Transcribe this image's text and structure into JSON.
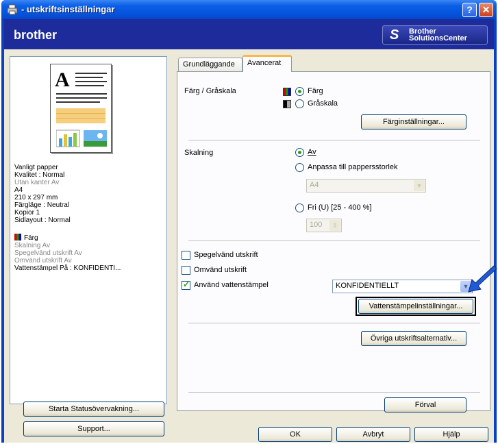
{
  "window": {
    "title": "- utskriftsinställningar",
    "help_glyph": "?",
    "close_glyph": "✕"
  },
  "brand": {
    "logo": "brother",
    "solutions_line1": "Brother",
    "solutions_line2": "SolutionsCenter"
  },
  "summary": {
    "lines": [
      "Vanligt papper",
      "Kvalitet : Normal",
      "Utan kanter Av",
      "A4",
      "210 x 297 mm",
      "Färgläge : Neutral",
      "Kopior 1",
      "Sidlayout : Normal"
    ],
    "color": "Färg",
    "details": [
      "Skalning Av",
      "Spegelvänd utskrift Av",
      "Omvänd utskrift Av",
      "Vattenstämpel På : KONFIDENTI..."
    ]
  },
  "left_buttons": {
    "status": "Starta Statusövervakning...",
    "support": "Support..."
  },
  "tabs": {
    "basic": "Grundläggande",
    "advanced": "Avancerat"
  },
  "color_section": {
    "label": "Färg / Gråskala",
    "color_option": "Färg",
    "gray_option": "Gråskala",
    "settings_button": "Färginställningar..."
  },
  "scaling_section": {
    "label": "Skalning",
    "off": "Av",
    "fit": "Anpassa till pappersstorlek",
    "paper_size": "A4",
    "free": "Fri (U) [25 - 400 %]",
    "percent": "100"
  },
  "options": {
    "mirror": "Spegelvänd utskrift",
    "reverse": "Omvänd utskrift",
    "watermark": "Använd vattenstämpel",
    "watermark_value": "KONFIDENTIELLT",
    "watermark_settings": "Vattenstämpelinställningar...",
    "other_options": "Övriga utskriftsalternativ...",
    "default": "Förval"
  },
  "footer": {
    "ok": "OK",
    "cancel": "Avbryt",
    "help": "Hjälp"
  },
  "colors": {
    "title_blue": "#0a5fe6",
    "brand_navy": "#1d2b9b",
    "arrow_blue": "#1f5bd6"
  }
}
